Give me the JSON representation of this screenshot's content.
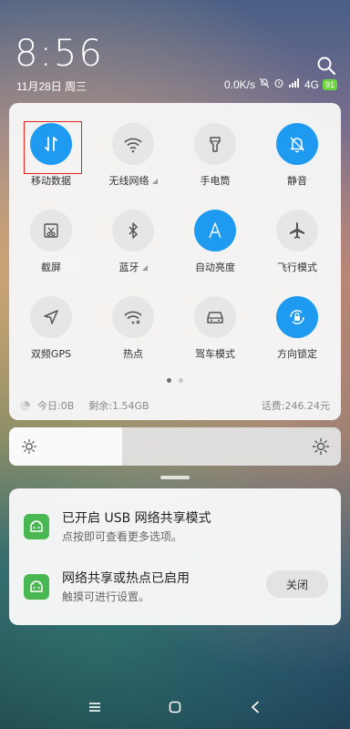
{
  "status": {
    "time": "8:56",
    "date": "11月28日 周三",
    "network_speed": "0.0K/s",
    "network_type": "4G",
    "battery": "91"
  },
  "tiles": [
    {
      "label": "移动数据",
      "on": true,
      "icon": "mobile-data-icon",
      "has_more": false
    },
    {
      "label": "无线网络",
      "on": false,
      "icon": "wifi-icon",
      "has_more": true
    },
    {
      "label": "手电筒",
      "on": false,
      "icon": "flashlight-icon",
      "has_more": false
    },
    {
      "label": "静音",
      "on": true,
      "icon": "mute-bell-icon",
      "has_more": false
    },
    {
      "label": "截屏",
      "on": false,
      "icon": "screenshot-icon",
      "has_more": false
    },
    {
      "label": "蓝牙",
      "on": false,
      "icon": "bluetooth-icon",
      "has_more": true
    },
    {
      "label": "自动亮度",
      "on": true,
      "icon": "auto-brightness-icon",
      "has_more": false
    },
    {
      "label": "飞行模式",
      "on": false,
      "icon": "airplane-icon",
      "has_more": false
    },
    {
      "label": "双频GPS",
      "on": false,
      "icon": "gps-icon",
      "has_more": false
    },
    {
      "label": "热点",
      "on": false,
      "icon": "hotspot-icon",
      "has_more": false
    },
    {
      "label": "驾车模式",
      "on": false,
      "icon": "car-icon",
      "has_more": false
    },
    {
      "label": "方向锁定",
      "on": true,
      "icon": "rotation-lock-icon",
      "has_more": false
    }
  ],
  "data_usage": {
    "today": "今日:0B",
    "remaining": "剩余:1.54GB",
    "fee": "话费:246.24元"
  },
  "brightness": {
    "level": 0.34
  },
  "notifications": [
    {
      "title": "已开启 USB 网络共享模式",
      "subtitle": "点按即可查看更多选项。"
    },
    {
      "title": "网络共享或热点已启用",
      "subtitle": "触摸可进行设置。",
      "action": "关闭"
    }
  ],
  "colors": {
    "accent": "#1e9bf0",
    "tile_off": "#e6e6e6",
    "highlight": "#e0231f",
    "app_icon": "#49b852",
    "battery": "#6bd43f"
  }
}
